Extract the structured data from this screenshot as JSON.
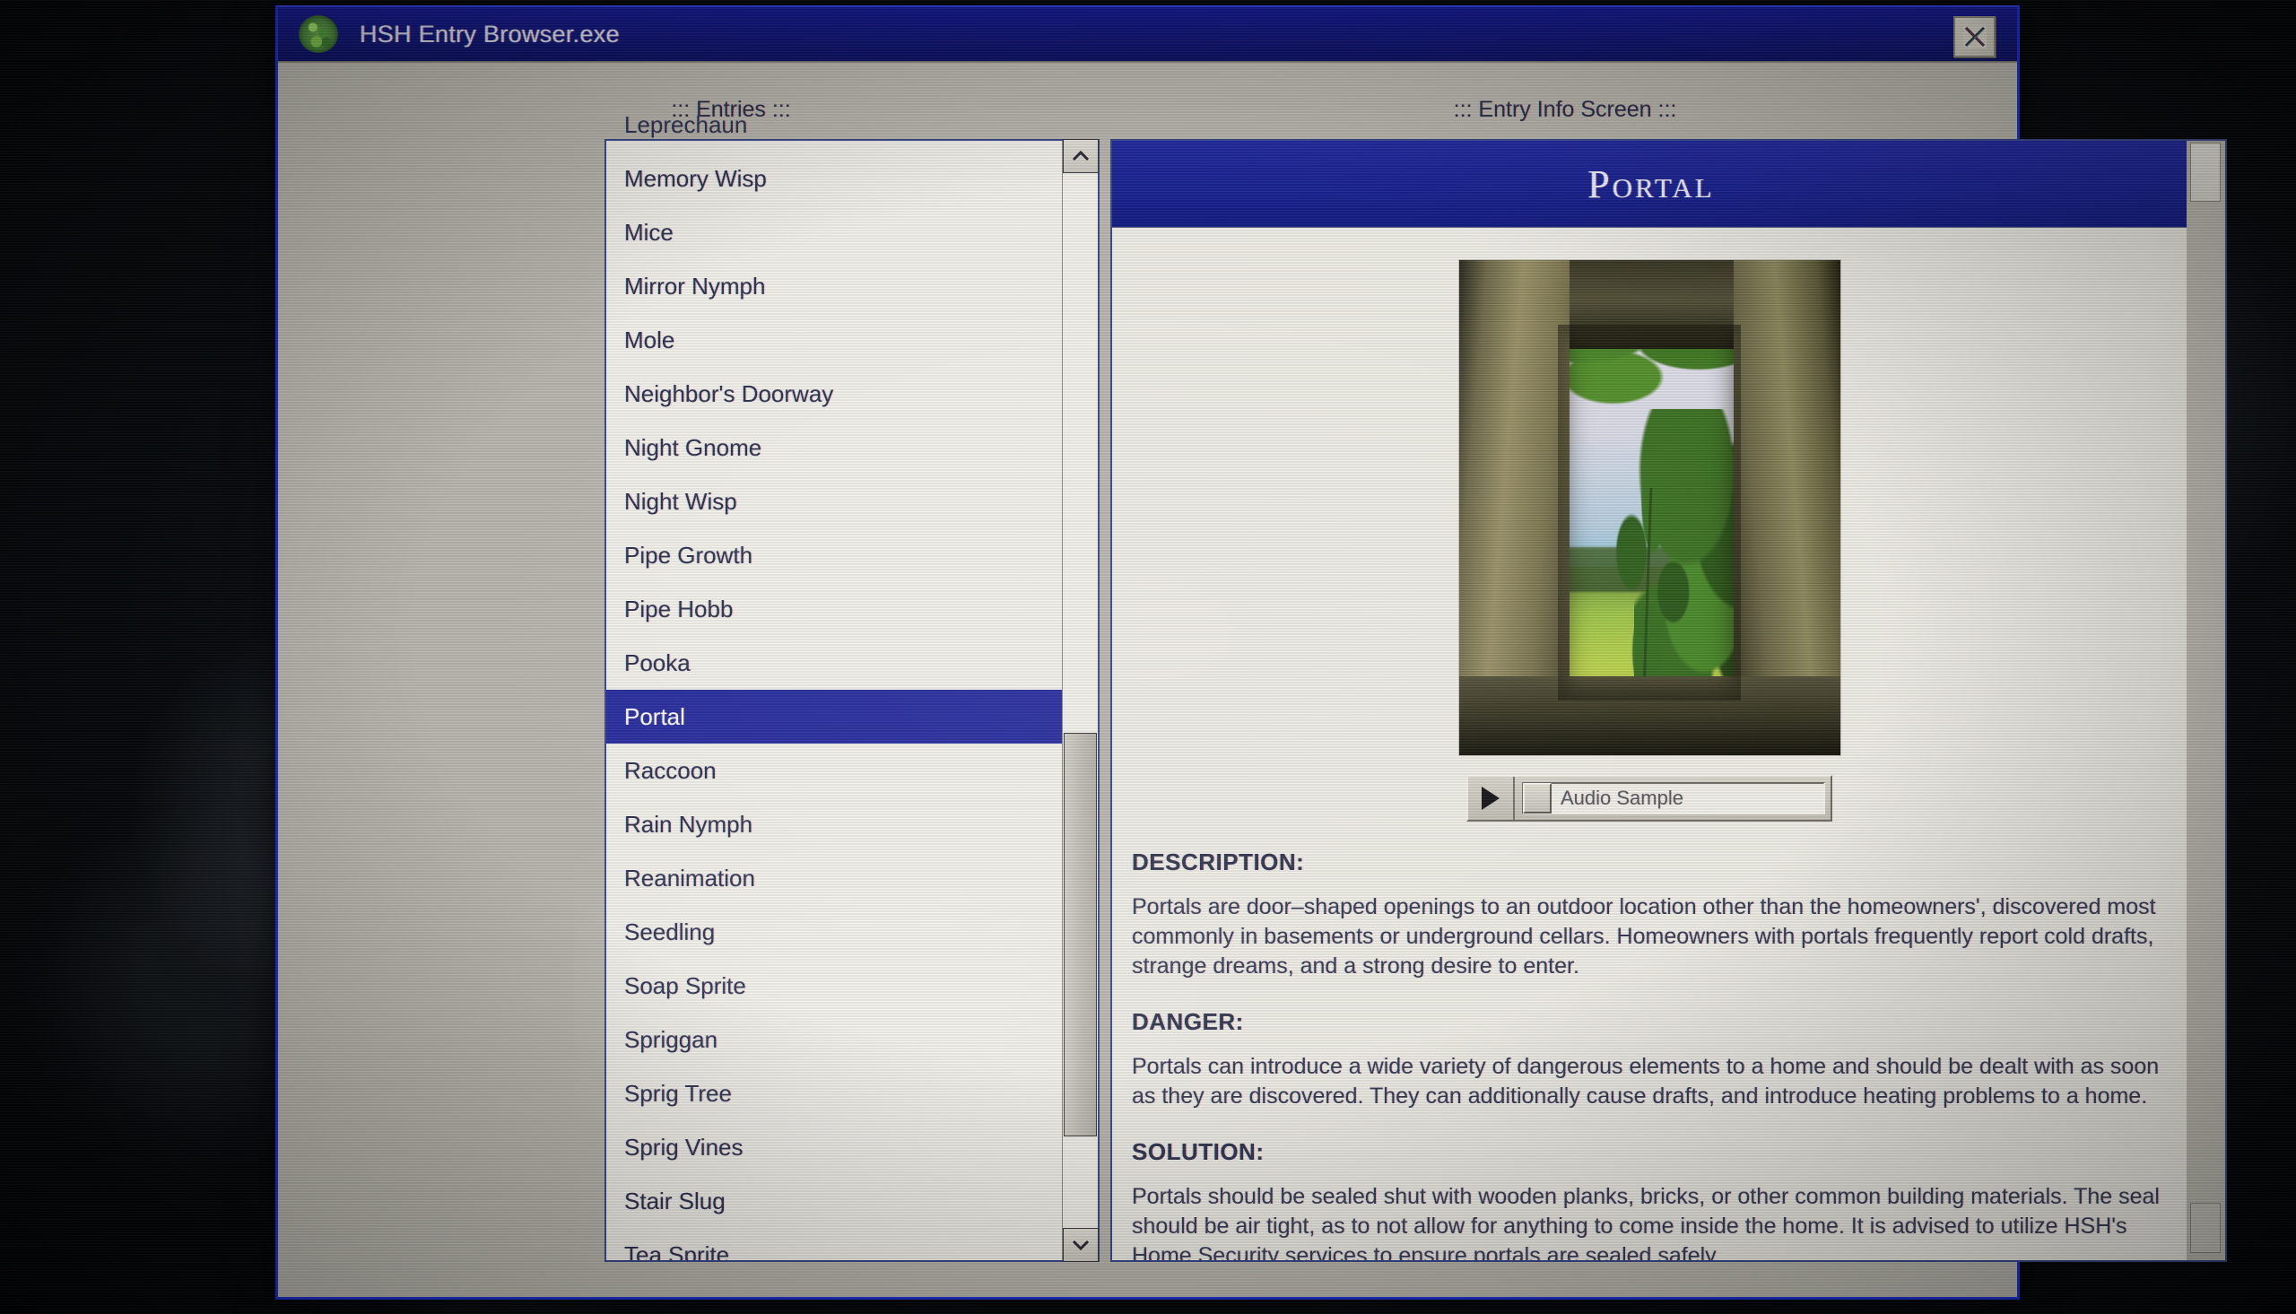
{
  "window": {
    "title": "HSH Entry Browser.exe",
    "app_icon": "globe-icon",
    "close_icon": "close-x-icon",
    "accent_titlebar": "#151a90",
    "accent_selection": "#2a2fa0"
  },
  "panels": {
    "entries_caption": "::: Entries :::",
    "info_caption": "::: Entry Info Screen :::"
  },
  "entries": {
    "items": [
      {
        "label": "Leprechaun",
        "selected": false,
        "partial": true
      },
      {
        "label": "Memory Wisp",
        "selected": false
      },
      {
        "label": "Mice",
        "selected": false
      },
      {
        "label": "Mirror Nymph",
        "selected": false
      },
      {
        "label": "Mole",
        "selected": false
      },
      {
        "label": "Neighbor's Doorway",
        "selected": false
      },
      {
        "label": "Night Gnome",
        "selected": false
      },
      {
        "label": "Night Wisp",
        "selected": false
      },
      {
        "label": "Pipe Growth",
        "selected": false
      },
      {
        "label": "Pipe Hobb",
        "selected": false
      },
      {
        "label": "Pooka",
        "selected": false
      },
      {
        "label": "Portal",
        "selected": true
      },
      {
        "label": "Raccoon",
        "selected": false
      },
      {
        "label": "Rain Nymph",
        "selected": false
      },
      {
        "label": "Reanimation",
        "selected": false
      },
      {
        "label": "Seedling",
        "selected": false
      },
      {
        "label": "Soap Sprite",
        "selected": false
      },
      {
        "label": "Spriggan",
        "selected": false
      },
      {
        "label": "Sprig Tree",
        "selected": false
      },
      {
        "label": "Sprig Vines",
        "selected": false
      },
      {
        "label": "Stair Slug",
        "selected": false
      },
      {
        "label": "Tea Sprite",
        "selected": false,
        "partial": true
      }
    ],
    "scroll_up_icon": "chevron-up-icon",
    "scroll_down_icon": "chevron-down-icon"
  },
  "entry": {
    "title": "Portal",
    "image_alt": "stone doorway opening onto a green field and sky",
    "audio": {
      "play_icon": "play-triangle-icon",
      "label": "Audio Sample"
    },
    "sections": [
      {
        "heading": "DESCRIPTION:",
        "body": "Portals are door–shaped openings to an outdoor location other than the homeowners', discovered most commonly in basements or underground cellars. Homeowners with portals frequently report cold drafts, strange dreams, and a strong desire to enter."
      },
      {
        "heading": "DANGER:",
        "body": "Portals can introduce a wide variety of dangerous elements to a home and should be dealt with as soon as they are discovered. They can additionally cause drafts, and introduce heating problems to a home."
      },
      {
        "heading": "SOLUTION:",
        "body": "Portals should be sealed shut with wooden planks, bricks, or other common building materials. The seal should be air tight, as to not allow for anything to come inside the home. It is advised to utilize HSH's Home Security services to ensure portals are sealed safely."
      }
    ]
  }
}
